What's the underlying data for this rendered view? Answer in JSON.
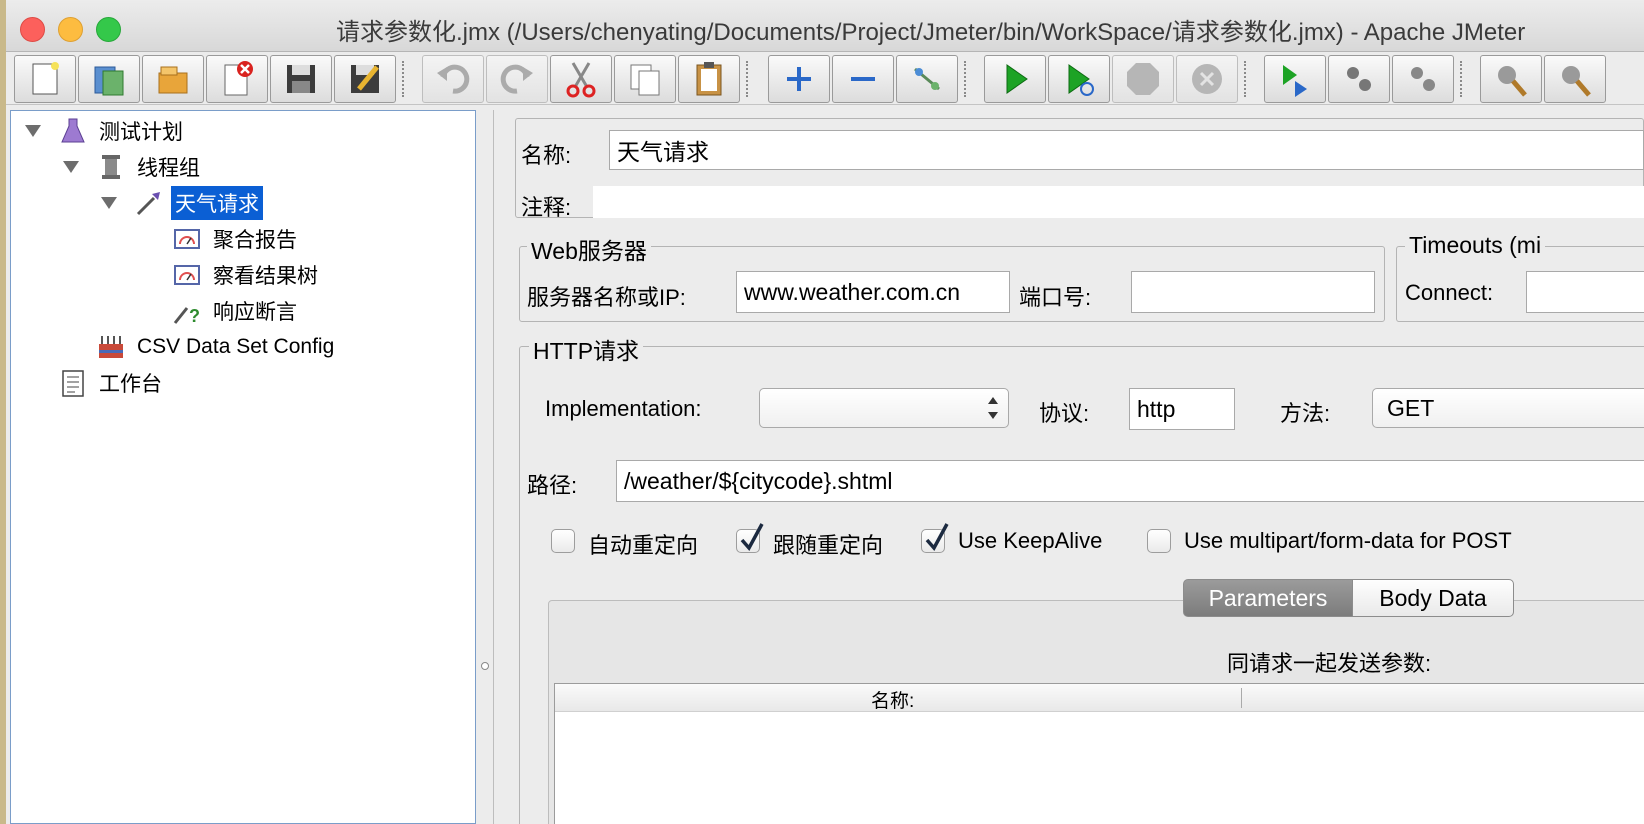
{
  "window": {
    "title": "请求参数化.jmx (/Users/chenyating/Documents/Project/Jmeter/bin/WorkSpace/请求参数化.jmx) - Apache JMeter"
  },
  "toolbar": {
    "buttons": [
      "new-icon",
      "templates-icon",
      "open-icon",
      "close-icon",
      "save-icon",
      "save-as-icon",
      "undo-icon",
      "redo-icon",
      "cut-icon",
      "copy-icon",
      "paste-icon",
      "expand-icon",
      "collapse-icon",
      "toggle-icon",
      "start-icon",
      "start-no-pause-icon",
      "stop-icon",
      "shutdown-icon",
      "remote-start-icon",
      "remote-stop-icon",
      "remote-shutdown-icon",
      "clear-icon",
      "clear-all-icon"
    ]
  },
  "tree": {
    "items": [
      {
        "label": "测试计划",
        "icon": "flask-icon"
      },
      {
        "label": "线程组",
        "icon": "spool-icon"
      },
      {
        "label": "天气请求",
        "icon": "sampler-pipette-icon",
        "selected": true
      },
      {
        "label": "聚合报告",
        "icon": "gauge-report-icon"
      },
      {
        "label": "察看结果树",
        "icon": "gauge-report-icon"
      },
      {
        "label": "响应断言",
        "icon": "assertion-icon"
      },
      {
        "label": "CSV Data Set Config",
        "icon": "csv-config-icon"
      },
      {
        "label": "工作台",
        "icon": "workbench-icon"
      }
    ]
  },
  "form": {
    "name_label": "名称:",
    "name_value": "天气请求",
    "comment_label": "注释:",
    "comment_value": "",
    "web_server": {
      "legend": "Web服务器",
      "server_label": "服务器名称或IP:",
      "server_value": "www.weather.com.cn",
      "port_label": "端口号:",
      "port_value": ""
    },
    "timeouts": {
      "legend": "Timeouts (mi",
      "connect_label": "Connect:"
    },
    "http": {
      "legend": "HTTP请求",
      "impl_label": "Implementation:",
      "impl_value": "",
      "protocol_label": "协议:",
      "protocol_value": "http",
      "method_label": "方法:",
      "method_value": "GET",
      "path_label": "路径:",
      "path_value": "/weather/${citycode}.shtml"
    },
    "checkboxes": [
      {
        "label": "自动重定向",
        "checked": false
      },
      {
        "label": "跟随重定向",
        "checked": true
      },
      {
        "label": "Use KeepAlive",
        "checked": true
      },
      {
        "label": "Use multipart/form-data for POST",
        "checked": false
      }
    ],
    "tabs": {
      "parameters": "Parameters",
      "body_data": "Body Data"
    },
    "params_caption": "同请求一起发送参数:",
    "table_header_name": "名称:"
  }
}
